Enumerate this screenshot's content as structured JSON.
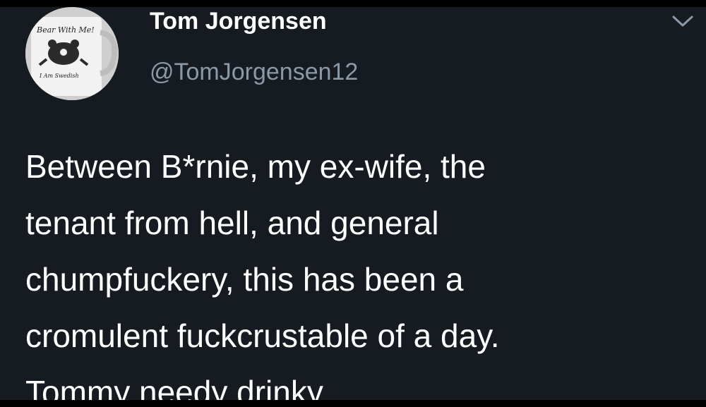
{
  "author": {
    "name": "Tom Jorgensen",
    "handle": "@TomJorgensen12",
    "avatar": {
      "icon": "avatar-mug-bear",
      "mug_text_top": "Bear With Me!",
      "mug_text_bottom": "I Am Swedish"
    }
  },
  "menu": {
    "icon": "chevron-down-icon"
  },
  "tweet": {
    "text": "Between B*rnie, my ex-wife, the\ntenant from hell, and general\nchumpfuckery, this has been a\ncromulent fuckcrustable of a day.\nTommy needy drinky."
  },
  "colors": {
    "background": "#161b22",
    "name": "#ffffff",
    "handle": "#8b98a5",
    "text": "#ffffff"
  }
}
